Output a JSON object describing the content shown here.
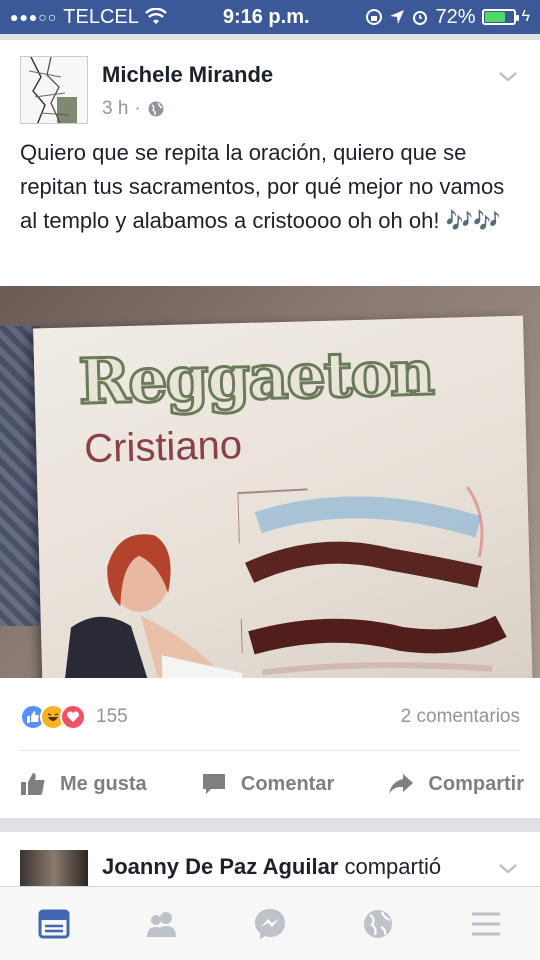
{
  "status_bar": {
    "signal_dots": "●●●○○",
    "carrier": "TELCEL",
    "time": "9:16 p.m.",
    "battery": "72%",
    "battery_level": 0.72
  },
  "post": {
    "author": "Michele Mirande",
    "time": "3 h",
    "separator": "·",
    "text": "Quiero que se repita la oración, quiero que se repitan tus sacramentos, por qué mejor no vamos al templo y alabamos a cristoooo oh oh oh! 🎶🎶",
    "image": {
      "title": "Reggaeton",
      "subtitle": "Cristiano"
    },
    "reactions_count": "155",
    "comments": "2 comentarios",
    "actions": {
      "like": "Me gusta",
      "comment": "Comentar",
      "share": "Compartir"
    }
  },
  "next_post": {
    "author": "Joanny De Paz Aguilar",
    "verb": "compartió"
  },
  "colors": {
    "brand": "#3b5998",
    "like_blue": "#5890ff",
    "haha_yellow": "#f7b125",
    "love_red": "#f25268",
    "tab_active": "#4267b2",
    "tab_inactive": "#bec2c9"
  }
}
